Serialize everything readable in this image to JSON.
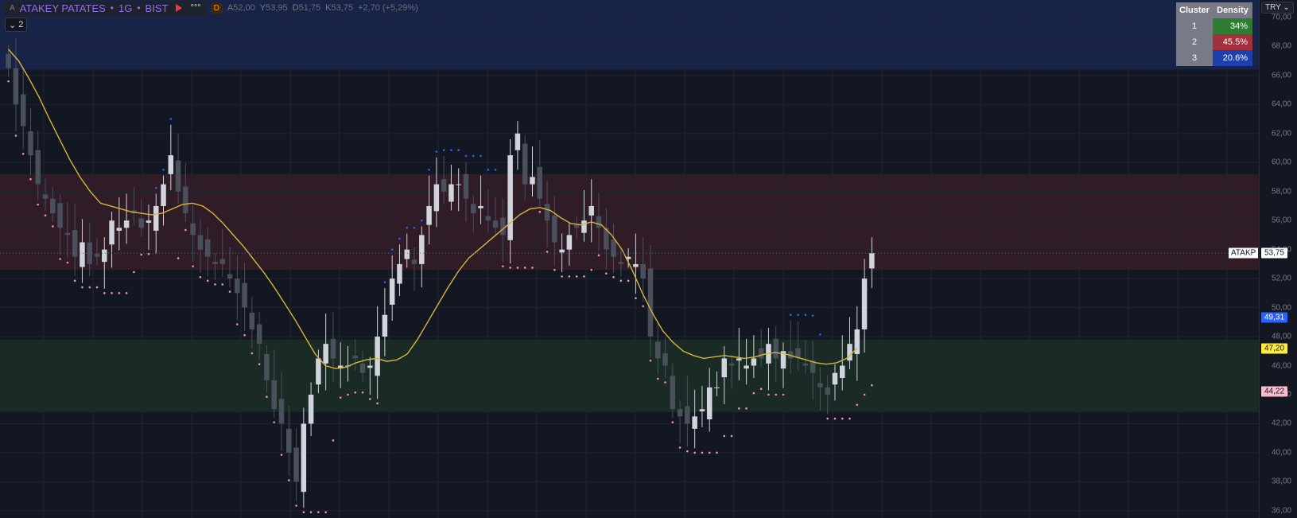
{
  "header": {
    "symbol": "ATAKEY PATATES",
    "interval": "1G",
    "exchange": "BIST",
    "symbol_prefix": "A",
    "separator": "•",
    "more": "°°°",
    "badge": "D",
    "ohlc": [
      {
        "key": "A",
        "value": "52,00"
      },
      {
        "key": "Y",
        "value": "53,95"
      },
      {
        "key": "D",
        "value": "51,75"
      },
      {
        "key": "K",
        "value": "53,75"
      }
    ],
    "change": "+2,70 (+5,29%)"
  },
  "legend_toggle": {
    "chevron": "⌄",
    "count": "2"
  },
  "currency": "TRY ⌄",
  "cluster_table": {
    "headers": [
      "Cluster",
      "Density"
    ],
    "rows": [
      {
        "cluster": "1",
        "density": "34%",
        "color": "#2e7d32"
      },
      {
        "cluster": "2",
        "density": "45.5%",
        "color": "#a3303a"
      },
      {
        "cluster": "3",
        "density": "20.6%",
        "color": "#1e40af"
      }
    ]
  },
  "price_labels": {
    "symbol": "ATAKP",
    "last": "53,75",
    "blue": "49,31",
    "yellow": "47,20",
    "pink": "44,22"
  },
  "colors": {
    "background": "#131722",
    "bull": "#d1d4dc",
    "bear": "#4a4f5c",
    "ema": "#d4b73a",
    "stop_pink": "#f48fb1",
    "stop_blue": "#2962ff",
    "zone_top": "#1a2a55",
    "zone_mid": "#3a1f2a",
    "zone_low": "#1c3325"
  },
  "chart_data": {
    "type": "candlestick",
    "y_ticks": [
      "70,00",
      "68,00",
      "66,00",
      "64,00",
      "62,00",
      "60,00",
      "58,00",
      "56,00",
      "54,00",
      "52,00",
      "50,00",
      "48,00",
      "46,00",
      "44,00",
      "42,00",
      "40,00",
      "38,00",
      "36,00"
    ],
    "ylim": [
      35.5,
      71.2
    ],
    "zones": [
      {
        "name": "cluster-3",
        "from": 66.4,
        "to": 71.2
      },
      {
        "name": "cluster-2",
        "from": 52.6,
        "to": 59.2
      },
      {
        "name": "cluster-1",
        "from": 42.8,
        "to": 47.8
      }
    ],
    "last_price": 53.75,
    "close": [
      66.5,
      64.0,
      62.5,
      60.5,
      58.5,
      57.5,
      56.5,
      55.5,
      55.0,
      53.5,
      54.5,
      53.0,
      53.5,
      54.0,
      56.0,
      55.5,
      56.0,
      56.5,
      55.5,
      56.0,
      57.0,
      58.5,
      60.5,
      58.0,
      56.5,
      55.0,
      54.0,
      53.5,
      53.0,
      53.0,
      52.0,
      51.0,
      50.0,
      48.5,
      47.5,
      45.0,
      43.0,
      42.0,
      40.0,
      38.0,
      42.0,
      44.0,
      46.5,
      47.5,
      46.5,
      46.0,
      46.0,
      46.5,
      45.5,
      46.0,
      48.0,
      49.5,
      52.0,
      53.0,
      54.0,
      53.0,
      55.0,
      57.0,
      58.5,
      58.0,
      58.5,
      58.5,
      57.5,
      56.5,
      57.0,
      56.0,
      55.5,
      55.0,
      60.5,
      62.0,
      58.5,
      59.0,
      57.5,
      56.0,
      54.5,
      54.0,
      55.0,
      55.5,
      56.0,
      57.0,
      55.5,
      54.0,
      53.5,
      53.0,
      53.5,
      53.0,
      52.0,
      48.0,
      46.5,
      46.0,
      43.0,
      42.5,
      42.0,
      42.5,
      43.0,
      44.5,
      44.5,
      46.5,
      46.0,
      46.5,
      46.0,
      46.5,
      46.5,
      47.5,
      46.5,
      47.0,
      46.5,
      46.5,
      46.0,
      45.5,
      44.5,
      44.0,
      45.5,
      46.0,
      47.5,
      48.5,
      52.0,
      53.75
    ],
    "ema": [
      67.8,
      67.0,
      65.8,
      64.5,
      63.0,
      61.6,
      60.2,
      59.0,
      58.0,
      57.2,
      57.0,
      56.8,
      56.6,
      56.5,
      56.4,
      56.5,
      56.8,
      57.1,
      57.2,
      57.0,
      56.5,
      55.8,
      55.0,
      54.2,
      53.3,
      52.4,
      51.4,
      50.3,
      49.2,
      48.0,
      46.8,
      46.0,
      45.8,
      45.9,
      46.2,
      46.4,
      46.5,
      46.3,
      46.4,
      46.8,
      47.8,
      49.0,
      50.2,
      51.4,
      52.5,
      53.4,
      54.0,
      54.6,
      55.2,
      55.8,
      56.4,
      56.8,
      56.9,
      56.7,
      56.2,
      55.8,
      55.7,
      55.9,
      55.7,
      55.0,
      54.0,
      52.6,
      51.0,
      49.6,
      48.4,
      47.6,
      47.0,
      46.7,
      46.5,
      46.6,
      46.7,
      46.6,
      46.5,
      46.6,
      46.8,
      46.9,
      46.8,
      46.6,
      46.4,
      46.2,
      46.1,
      46.2,
      46.5,
      47.2
    ],
    "ema_start": 0,
    "ema_stretch": 116
  }
}
